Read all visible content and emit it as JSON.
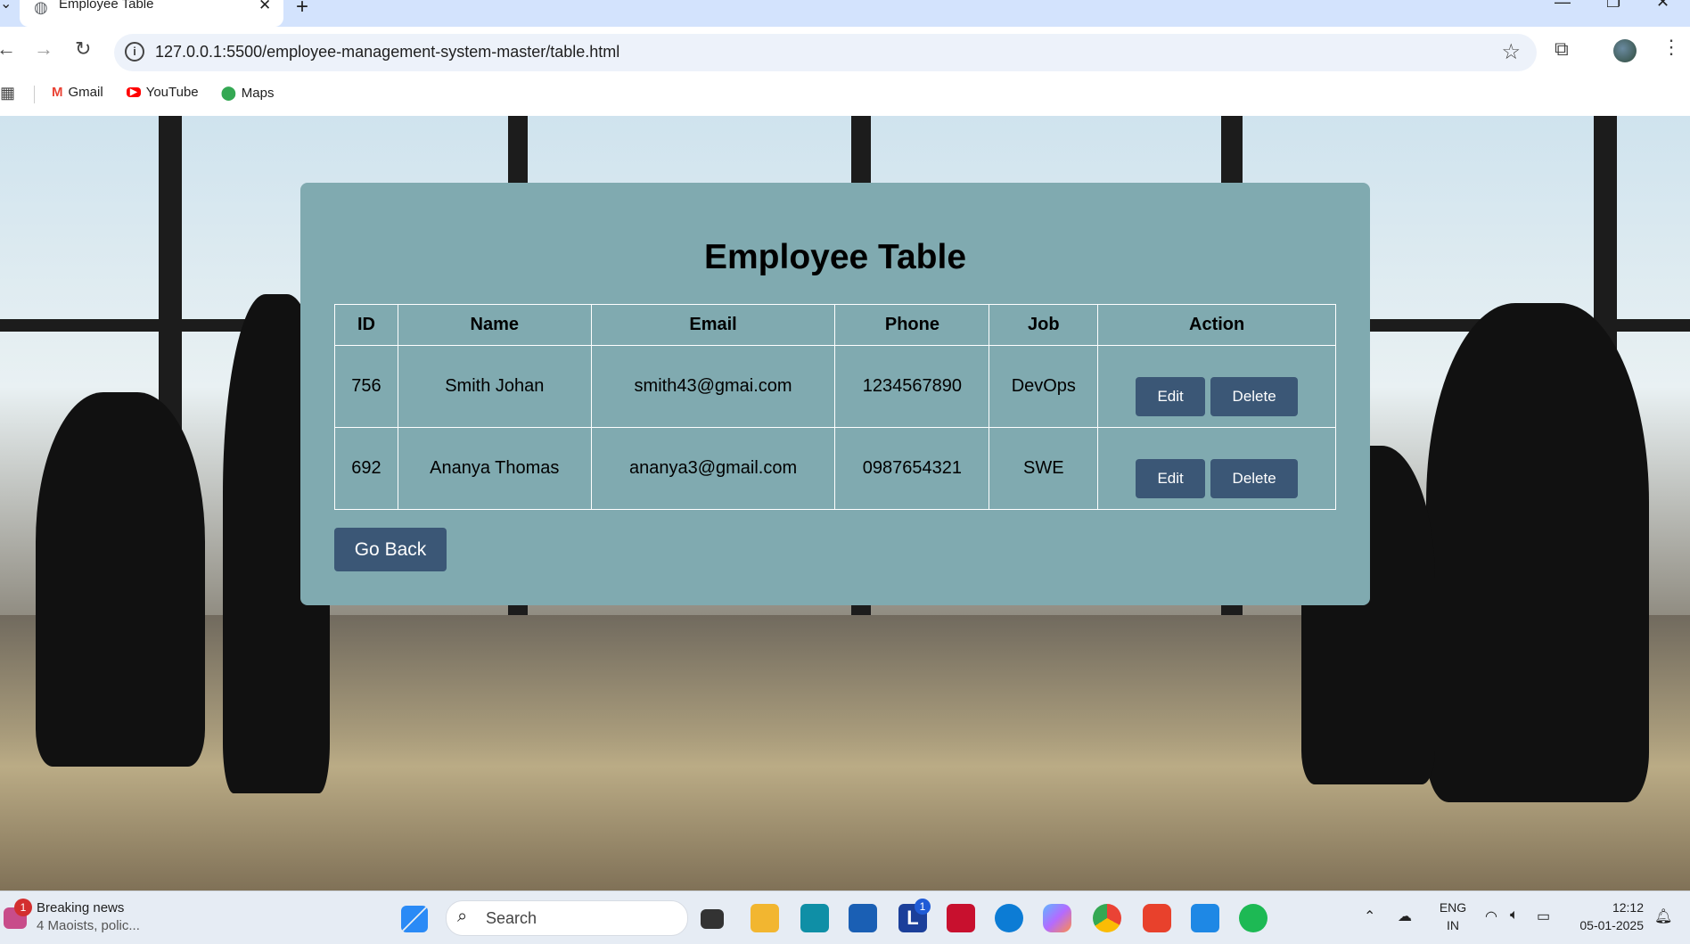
{
  "browser": {
    "tab_title": "Employee Table",
    "url": "127.0.0.1:5500/employee-management-system-master/table.html",
    "bookmarks": [
      {
        "label": "Gmail",
        "icon": "gmail-icon"
      },
      {
        "label": "YouTube",
        "icon": "youtube-icon"
      },
      {
        "label": "Maps",
        "icon": "maps-icon"
      }
    ]
  },
  "page": {
    "heading": "Employee Table",
    "columns": [
      "ID",
      "Name",
      "Email",
      "Phone",
      "Job",
      "Action"
    ],
    "rows": [
      {
        "id": "756",
        "name": "Smith Johan",
        "email": "smith43@gmai.com",
        "phone": "1234567890",
        "job": "DevOps"
      },
      {
        "id": "692",
        "name": "Ananya Thomas",
        "email": "ananya3@gmail.com",
        "phone": "0987654321",
        "job": "SWE"
      }
    ],
    "edit_label": "Edit",
    "delete_label": "Delete",
    "go_back_label": "Go Back"
  },
  "taskbar": {
    "news_title": "Breaking news",
    "news_sub": "4 Maoists, polic...",
    "news_badge": "1",
    "search_label": "Search",
    "lang_top": "ENG",
    "lang_bottom": "IN",
    "time": "12:12",
    "date": "05-01-2025",
    "teams_badge": "1"
  },
  "colors": {
    "card_bg": "#80aab0",
    "button_bg": "#3b5776",
    "tabstrip_bg": "#d3e3fd"
  }
}
